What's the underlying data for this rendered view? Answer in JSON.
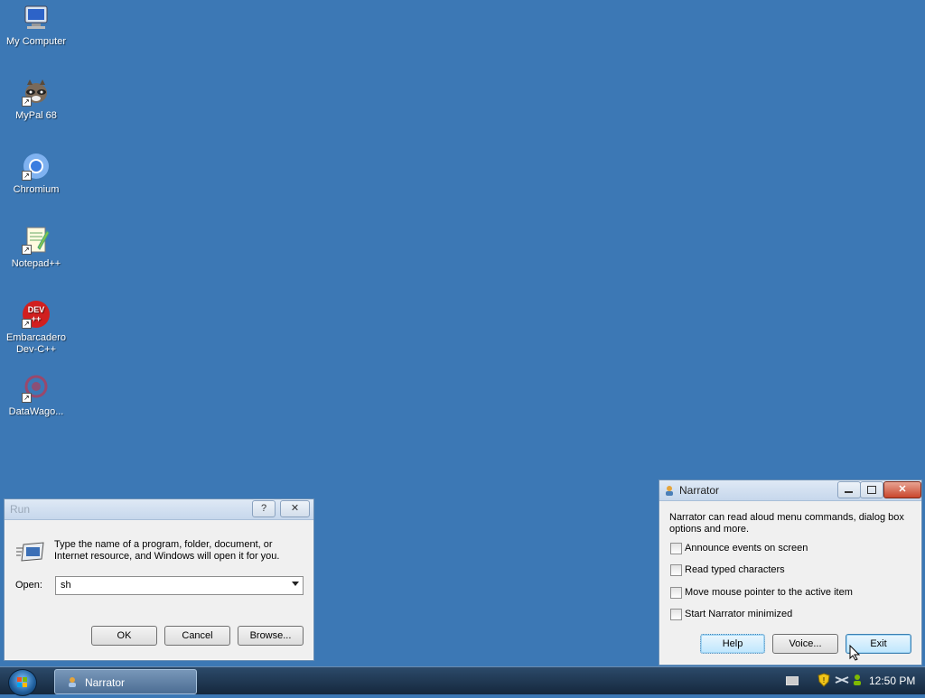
{
  "desktop": {
    "icons": [
      {
        "label": "My Computer",
        "icon": "computer-icon"
      },
      {
        "label": "MyPal 68",
        "icon": "raccoon-icon"
      },
      {
        "label": "Chromium",
        "icon": "chromium-icon"
      },
      {
        "label": "Notepad++",
        "icon": "notepad-icon"
      },
      {
        "label": "Embarcadero Dev-C++",
        "icon": "devcpp-icon"
      },
      {
        "label": "DataWago...",
        "icon": "datawagon-icon"
      }
    ]
  },
  "run_dialog": {
    "title": "Run",
    "help_btn": "?",
    "close_btn": "✕",
    "description": "Type the name of a program, folder, document, or Internet resource, and Windows will open it for you.",
    "open_label": "Open:",
    "open_value": "sh",
    "ok": "OK",
    "cancel": "Cancel",
    "browse": "Browse..."
  },
  "narrator": {
    "title": "Narrator",
    "description": "Narrator can read aloud menu commands, dialog box options and more.",
    "options": [
      {
        "label": "Announce events on screen",
        "checked": false
      },
      {
        "label": "Read typed characters",
        "checked": false
      },
      {
        "label": "Move mouse pointer to the active item",
        "checked": false
      },
      {
        "label": "Start Narrator minimized",
        "checked": false
      }
    ],
    "help": "Help",
    "voice": "Voice...",
    "exit": "Exit"
  },
  "taskbar": {
    "task_label": "Narrator",
    "clock": "12:50 PM"
  },
  "colors": {
    "desktop": "#3c78b5",
    "taskbar": "#1f3550"
  }
}
